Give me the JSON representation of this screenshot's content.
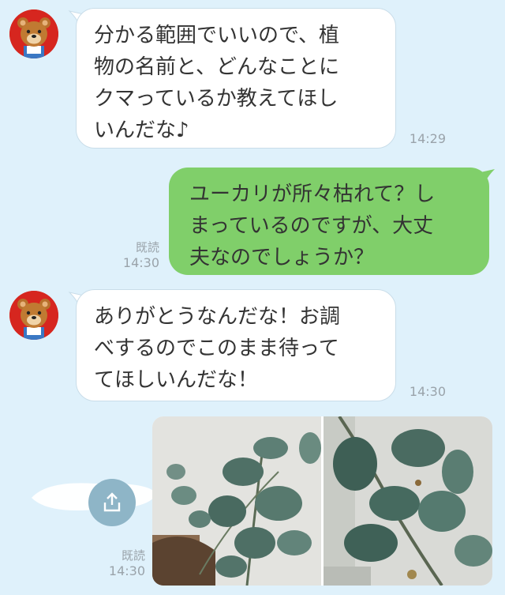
{
  "messages": [
    {
      "sender": "bear",
      "text": "分かる範囲でいいので、植\n物の名前と、どんなことに\nクマっているか教えてほし\nいんだな♪",
      "time": "14:29"
    },
    {
      "sender": "user",
      "text": "ユーカリが所々枯れて？し\nまっているのですが、大丈\n夫なのでしょうか？",
      "read": "既読",
      "time": "14:30"
    },
    {
      "sender": "bear",
      "text": "ありがとうなんだな！お調\nべするのでこのまま待って\nてほしいんだな！",
      "time": "14:30"
    },
    {
      "sender": "user",
      "type": "photos",
      "read": "既読",
      "time": "14:30"
    }
  ],
  "icons": {
    "avatar": "bear-mascot-icon",
    "share": "share-icon"
  },
  "colors": {
    "background": "#dff1fb",
    "incoming_bubble": "#ffffff",
    "outgoing_bubble": "#80cf6a",
    "avatar_bg": "#d6261f",
    "share_button": "#8eb5c7"
  }
}
